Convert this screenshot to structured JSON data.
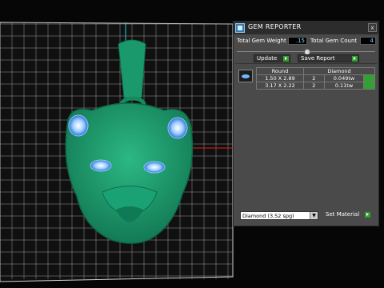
{
  "colors": {
    "accent_green": "#2fa22f",
    "value_cyan": "#7fd9ff",
    "pendant_green": "#1f9f72",
    "gem_blue": "#6fb8ff",
    "grid": "#bdbdbd"
  },
  "viewport": {
    "subject": "tiger-head-pendant-model"
  },
  "panel": {
    "title": "GEM REPORTER",
    "close_label": "x",
    "app_icon": "gem-reporter-app-icon",
    "weight_label": "Total Gem Weight",
    "weight_value": ".15",
    "count_label": "Total Gem Count",
    "count_value": "4",
    "update_label": "Update",
    "save_report_label": "Save Report",
    "table": {
      "headers": [
        "Round",
        "Diamond"
      ],
      "rows": [
        {
          "size": "1.50 X 2.89",
          "count": "2",
          "weight": "0.049tw"
        },
        {
          "size": "3.17 X 2.22",
          "count": "2",
          "weight": "0.11tw"
        }
      ]
    },
    "material_value": "Diamond    (3.52 spg)",
    "set_material_label": "Set Material"
  }
}
